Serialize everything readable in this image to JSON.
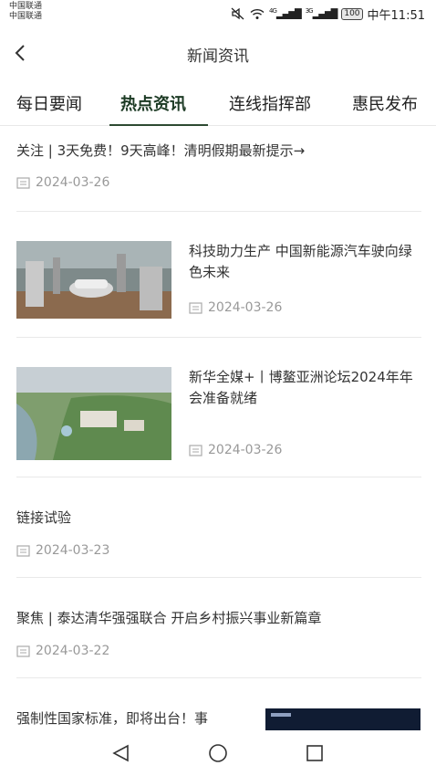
{
  "status": {
    "carrier1": "中国联通",
    "carrier2": "中国联通",
    "net1": "4G",
    "net2": "3G",
    "battery": "100",
    "time": "中午11:51"
  },
  "header": {
    "title": "新闻资讯"
  },
  "tabs": [
    {
      "label": "每日要闻",
      "active": false
    },
    {
      "label": "热点资讯",
      "active": true
    },
    {
      "label": "连线指挥部",
      "active": false
    },
    {
      "label": "惠民发布",
      "active": false
    }
  ],
  "news": [
    {
      "title": "关注 | 3天免费！9天高峰！清明假期最新提示→",
      "date": "2024-03-26"
    },
    {
      "title": "科技助力生产 中国新能源汽车驶向绿色未来",
      "date": "2024-03-26",
      "image": "factory-image"
    },
    {
      "title": "新华全媒+丨博鳌亚洲论坛2024年年会准备就绪",
      "date": "2024-03-26",
      "image": "aerial-resort-image"
    },
    {
      "title": "链接试验",
      "date": "2024-03-23"
    },
    {
      "title": "聚焦 | 泰达清华强强联合 开启乡村振兴事业新篇章",
      "date": "2024-03-22"
    },
    {
      "title": "强制性国家标准，即将出台！事",
      "image": "dark-banner-image"
    }
  ],
  "icons": {
    "back": "chevron-left-icon",
    "date": "calendar-icon",
    "nav_back": "triangle-back-icon",
    "nav_home": "circle-home-icon",
    "nav_recent": "square-recent-icon"
  },
  "colors": {
    "active_tab": "#1c3a24",
    "underline": "#2d4a32",
    "date": "#999999"
  }
}
